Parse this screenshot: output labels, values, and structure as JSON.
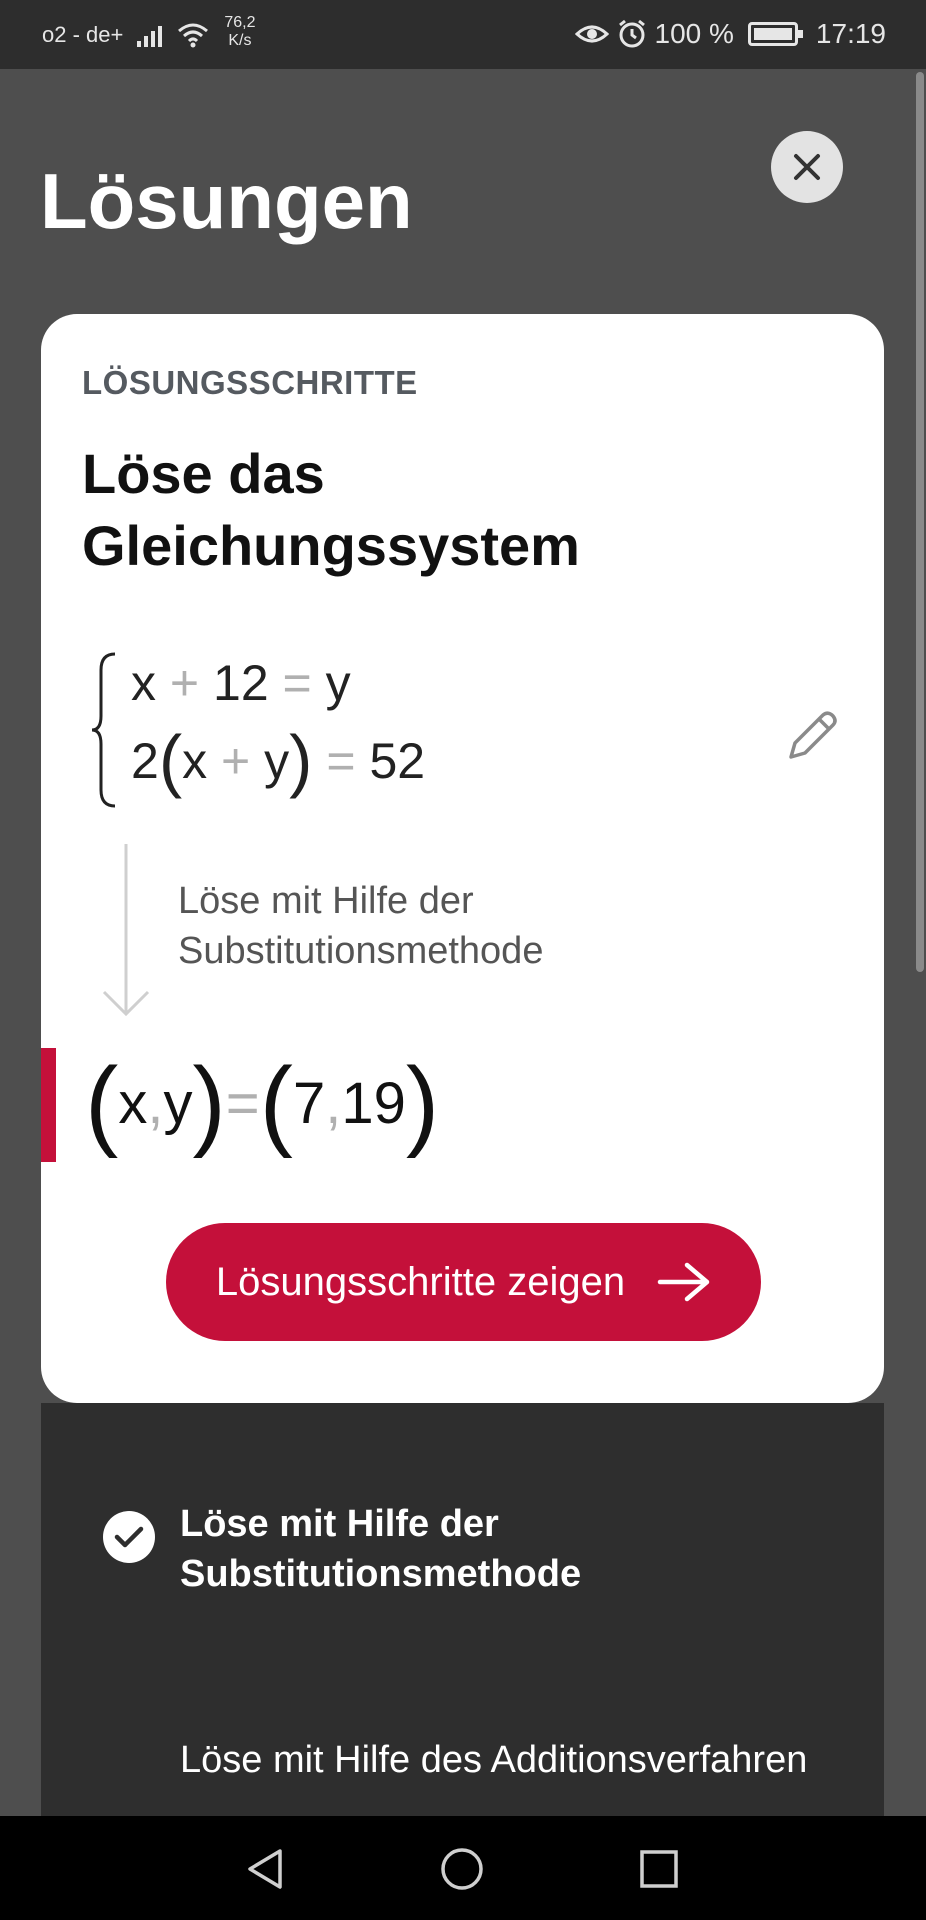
{
  "status_bar": {
    "carrier": "o2 - de+",
    "data_rate_value": "76,2",
    "data_rate_unit": "K/s",
    "battery": "100 %",
    "time": "17:19"
  },
  "header": {
    "title": "Lösungen",
    "close_icon": "close-icon"
  },
  "card": {
    "eyebrow": "LÖSUNGSSCHRITTE",
    "title": "Löse das Gleichungssystem",
    "equations": {
      "line1": {
        "lhs": "x",
        "op": "+",
        "term": "12",
        "eq": "=",
        "rhs": "y"
      },
      "line2": {
        "coef": "2",
        "open": "(",
        "a": "x",
        "op": "+",
        "b": "y",
        "close": ")",
        "eq": "=",
        "rhs": "52"
      }
    },
    "step_description": "Löse mit Hilfe der Substitutionsmethode",
    "result": {
      "lhs_a": "x",
      "lhs_b": "y",
      "rhs_a": "7",
      "rhs_b": "19",
      "separator": ",",
      "equals": "="
    },
    "cta_label": "Lösungsschritte zeigen",
    "accent_color": "#c4103a"
  },
  "methods": [
    {
      "label": "Löse mit Hilfe der Substitutionsmethode",
      "selected": true,
      "icon": "check-circle-icon"
    },
    {
      "label": "Löse mit Hilfe des Additionsverfahren",
      "selected": false
    }
  ],
  "navbar": {
    "back_icon": "back-triangle-icon",
    "home_icon": "home-circle-icon",
    "recents_icon": "recents-square-icon"
  }
}
